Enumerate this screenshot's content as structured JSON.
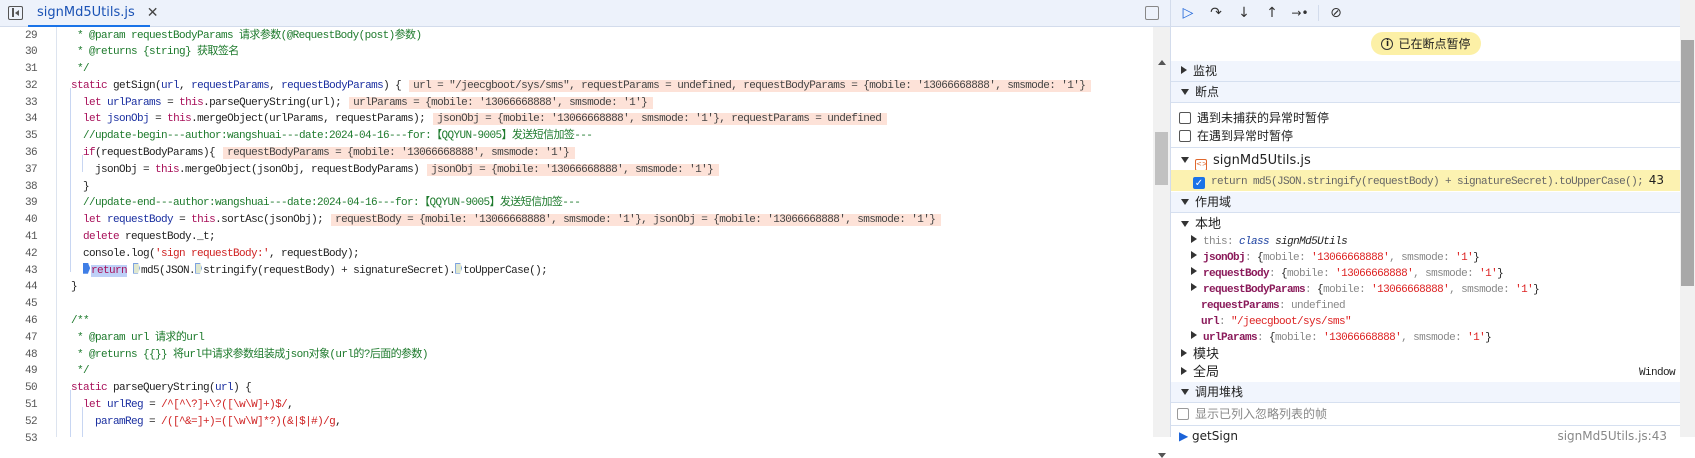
{
  "tab": {
    "label": "signMd5Utils.js",
    "close": "✕"
  },
  "code": [
    {
      "n": "29",
      "t": [
        [
          "c",
          " * @param requestBodyParams 请求参数(@RequestBody(post)参数)"
        ]
      ]
    },
    {
      "n": "30",
      "t": [
        [
          "c",
          " * @returns {string} 获取签名"
        ]
      ]
    },
    {
      "n": "31",
      "t": [
        [
          "c",
          " */"
        ]
      ]
    },
    {
      "n": "32",
      "t": [
        [
          "k",
          "static"
        ],
        [
          "p",
          " getSign("
        ],
        [
          "v",
          "url"
        ],
        [
          "p",
          ", "
        ],
        [
          "v",
          "requestParams"
        ],
        [
          "p",
          ", "
        ],
        [
          "v",
          "requestBodyParams"
        ],
        [
          "p",
          ") {"
        ]
      ],
      "inline": "url = \"/jeecgboot/sys/sms\", requestParams = undefined, requestBodyParams = {mobile: '13066668888', smsmode: '1'}"
    },
    {
      "n": "33",
      "t": [
        [
          "p",
          "  "
        ],
        [
          "k",
          "let"
        ],
        [
          "p",
          " "
        ],
        [
          "v",
          "urlParams"
        ],
        [
          "p",
          " = "
        ],
        [
          "k",
          "this"
        ],
        [
          "p",
          ".parseQueryString(url);"
        ]
      ],
      "inline": "urlParams = {mobile: '13066668888', smsmode: '1'}"
    },
    {
      "n": "34",
      "t": [
        [
          "p",
          "  "
        ],
        [
          "k",
          "let"
        ],
        [
          "p",
          " "
        ],
        [
          "v",
          "jsonObj"
        ],
        [
          "p",
          " = "
        ],
        [
          "k",
          "this"
        ],
        [
          "p",
          ".mergeObject(urlParams, requestParams);"
        ]
      ],
      "inline": "jsonObj = {mobile: '13066668888', smsmode: '1'}, requestParams = undefined"
    },
    {
      "n": "35",
      "t": [
        [
          "c",
          "  //update-begin---author:wangshuai---date:2024-04-16---for:【QQYUN-9005】发送短信加签---"
        ]
      ]
    },
    {
      "n": "36",
      "t": [
        [
          "p",
          "  "
        ],
        [
          "k",
          "if"
        ],
        [
          "p",
          "(requestBodyParams){"
        ]
      ],
      "inline": "requestBodyParams = {mobile: '13066668888', smsmode: '1'}"
    },
    {
      "n": "37",
      "t": [
        [
          "p",
          "    jsonObj = "
        ],
        [
          "k",
          "this"
        ],
        [
          "p",
          ".mergeObject(jsonObj, requestBodyParams)"
        ]
      ],
      "inline": "jsonObj = {mobile: '13066668888', smsmode: '1'}"
    },
    {
      "n": "38",
      "t": [
        [
          "p",
          "  }"
        ]
      ]
    },
    {
      "n": "39",
      "t": [
        [
          "c",
          "  //update-end---author:wangshuai---date:2024-04-16---for:【QQYUN-9005】发送短信加签---"
        ]
      ]
    },
    {
      "n": "40",
      "t": [
        [
          "p",
          "  "
        ],
        [
          "k",
          "let"
        ],
        [
          "p",
          " "
        ],
        [
          "v",
          "requestBody"
        ],
        [
          "p",
          " = "
        ],
        [
          "k",
          "this"
        ],
        [
          "p",
          ".sortAsc(jsonObj);"
        ]
      ],
      "inline": "requestBody = {mobile: '13066668888', smsmode: '1'}, jsonObj = {mobile: '13066668888', smsmode: '1'}"
    },
    {
      "n": "41",
      "t": [
        [
          "p",
          "  "
        ],
        [
          "k",
          "delete"
        ],
        [
          "p",
          " requestBody._t;"
        ]
      ]
    },
    {
      "n": "42",
      "t": [
        [
          "p",
          "  console.log("
        ],
        [
          "s",
          "'sign requestBody:'"
        ],
        [
          "p",
          ", requestBody);"
        ]
      ]
    },
    {
      "n": "43",
      "current": true,
      "t": [
        [
          "p",
          "  "
        ],
        [
          "mk1",
          ""
        ],
        [
          "sel",
          "return"
        ],
        [
          "p",
          " "
        ],
        [
          "mk",
          ""
        ],
        [
          "p",
          "md5(JSON."
        ],
        [
          "mk",
          ""
        ],
        [
          "p",
          "stringify(requestBody) + signatureSecret)."
        ],
        [
          "mk",
          ""
        ],
        [
          "p",
          "toUpperCase();"
        ]
      ]
    },
    {
      "n": "44",
      "t": [
        [
          "p",
          "}"
        ]
      ]
    },
    {
      "n": "45",
      "t": [
        [
          "p",
          ""
        ]
      ]
    },
    {
      "n": "46",
      "t": [
        [
          "c",
          "/**"
        ]
      ]
    },
    {
      "n": "47",
      "t": [
        [
          "c",
          " * @param url 请求的url"
        ]
      ]
    },
    {
      "n": "48",
      "t": [
        [
          "c",
          " * @returns {{}} 将url中请求参数组装成json对象(url的?后面的参数)"
        ]
      ]
    },
    {
      "n": "49",
      "t": [
        [
          "c",
          " */"
        ]
      ]
    },
    {
      "n": "50",
      "t": [
        [
          "k",
          "static"
        ],
        [
          "p",
          " parseQueryString("
        ],
        [
          "v",
          "url"
        ],
        [
          "p",
          ") {"
        ]
      ]
    },
    {
      "n": "51",
      "t": [
        [
          "p",
          "  "
        ],
        [
          "k",
          "let"
        ],
        [
          "p",
          " "
        ],
        [
          "v",
          "urlReg"
        ],
        [
          "p",
          " = "
        ],
        [
          "s",
          "/^[^\\?]+\\?([\\w\\W]+)$/"
        ],
        [
          "p",
          ","
        ]
      ]
    },
    {
      "n": "52",
      "t": [
        [
          "p",
          "    "
        ],
        [
          "v",
          "paramReg"
        ],
        [
          "p",
          " = "
        ],
        [
          "s",
          "/([^&=]+)=([\\w\\W]*?)(&|$|#)/g"
        ],
        [
          "p",
          ","
        ]
      ]
    },
    {
      "n": "53",
      "t": [
        [
          "p",
          ""
        ]
      ]
    }
  ],
  "debugger": {
    "toolbar": {
      "resume": "▷",
      "step_over": "↷",
      "step_into": "↓",
      "step_out": "↑",
      "step": "→•",
      "deactivate": "⊘"
    },
    "paused_label": "已在断点暂停",
    "sections": {
      "watch": "监视",
      "breakpoints": "断点",
      "scope": "作用域",
      "call_stack": "调用堆栈"
    },
    "pause_uncaught": "遇到未捕获的异常时暂停",
    "pause_caught": "在遇到异常时暂停",
    "bp_file": "signMd5Utils.js",
    "bp_code": "return md5(JSON.stringify(requestBody) + signatureSecret).toUpperCase();",
    "bp_line": "43",
    "scope": {
      "local_label": "本地",
      "this_name": "this",
      "this_kw": "class",
      "this_val": "signMd5Utils",
      "vars": [
        {
          "name": "jsonObj",
          "mobile": "'13066668888'",
          "smsmode": "'1'"
        },
        {
          "name": "requestBody",
          "mobile": "'13066668888'",
          "smsmode": "'1'"
        },
        {
          "name": "requestBodyParams",
          "mobile": "'13066668888'",
          "smsmode": "'1'"
        }
      ],
      "requestParams_name": "requestParams",
      "requestParams_val": "undefined",
      "url_name": "url",
      "url_val": "\"/jeecgboot/sys/sms\"",
      "urlParams": {
        "name": "urlParams",
        "mobile": "'13066668888'",
        "smsmode": "'1'"
      },
      "key_mobile": "mobile",
      "key_smsmode": "smsmode",
      "module_label": "模块",
      "global_label": "全局",
      "global_val": "Window"
    },
    "show_ignored": "显示已列入忽略列表的帧",
    "frame": {
      "name": "getSign",
      "location": "signMd5Utils.js:43"
    }
  }
}
